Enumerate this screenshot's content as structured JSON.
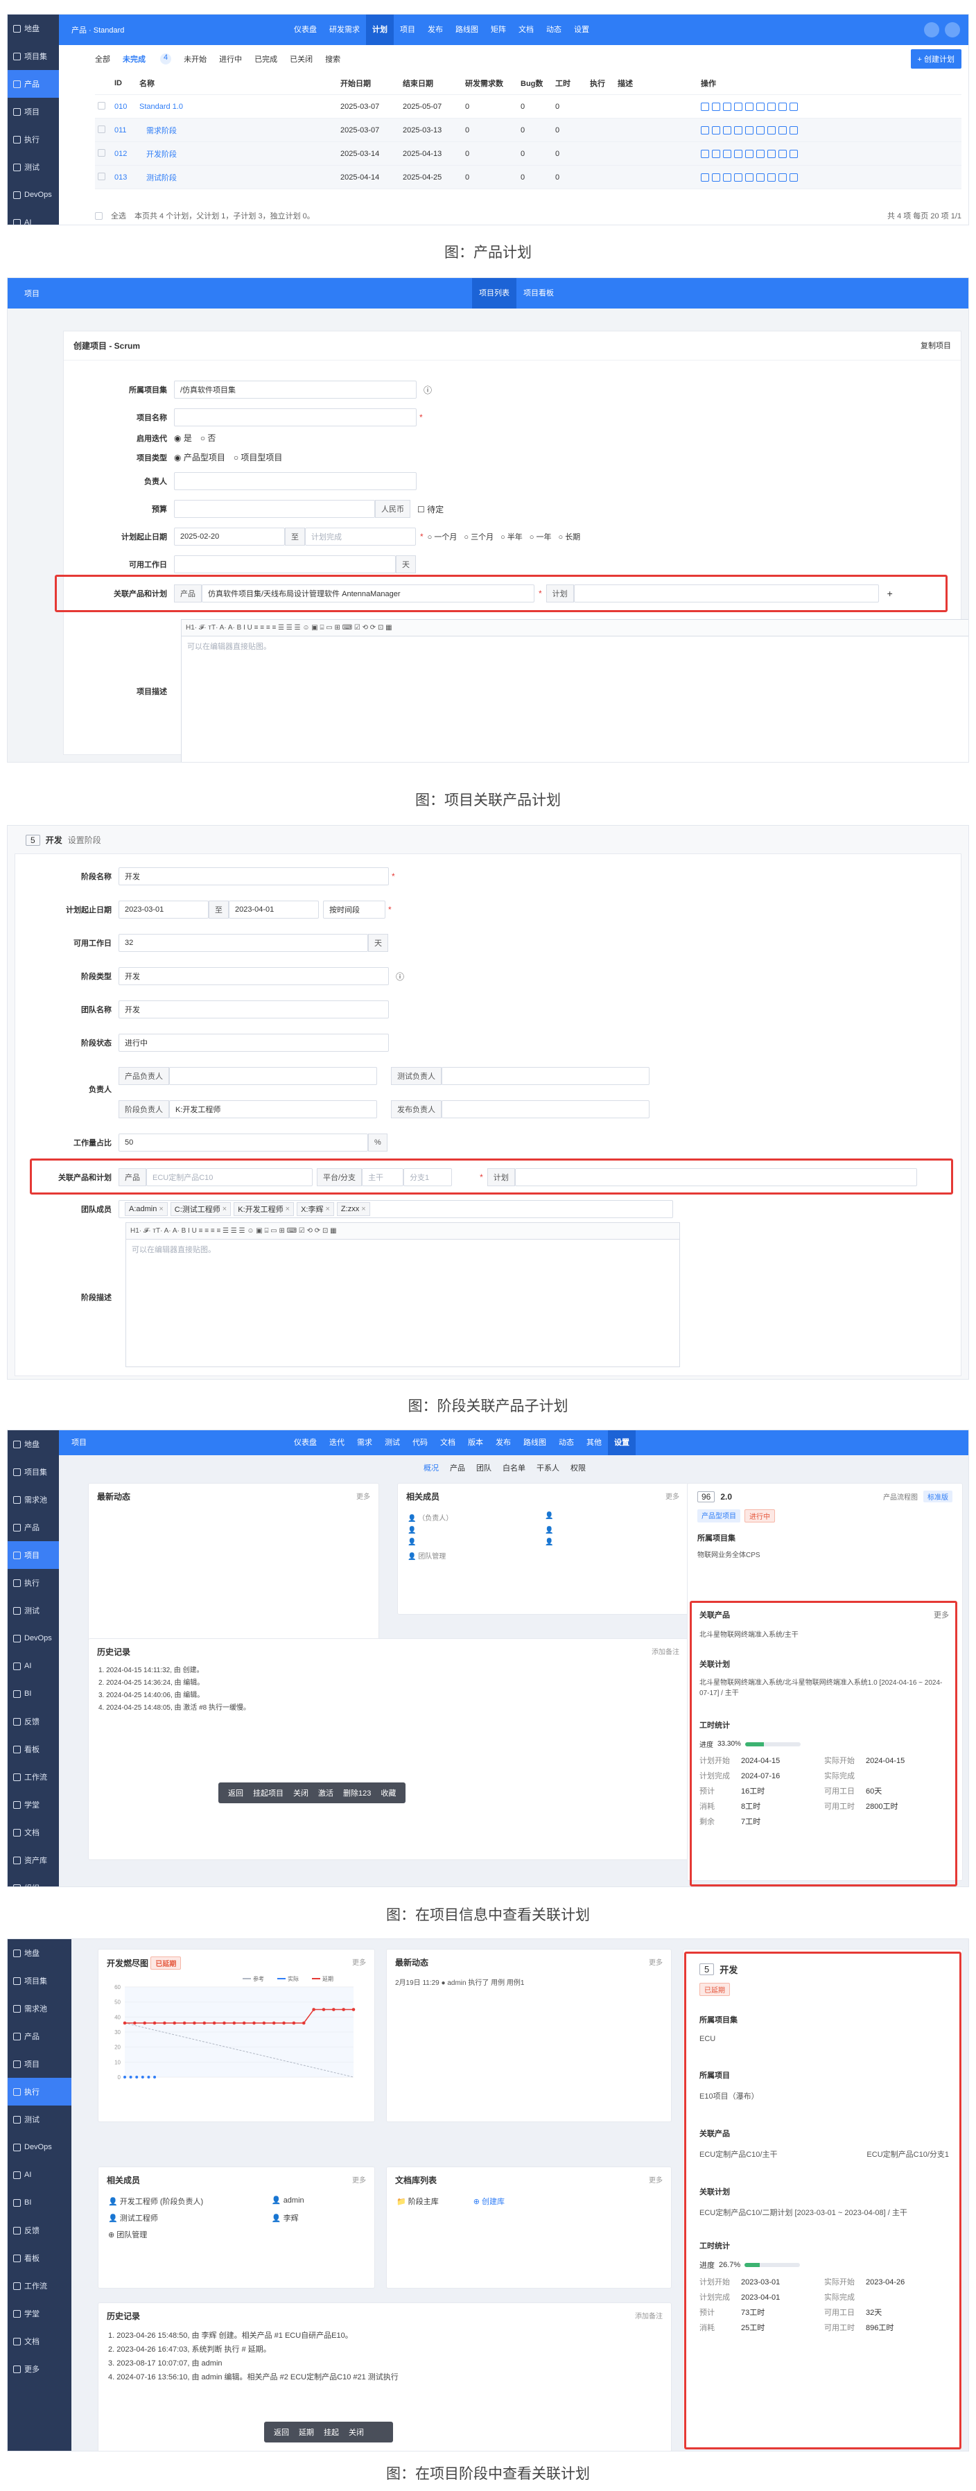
{
  "s1": {
    "sidebar": [
      "地盘",
      "项目集",
      "产品",
      "项目",
      "执行",
      "测试",
      "DevOps",
      "AI"
    ],
    "crumb": "产品 · Standard",
    "nav": [
      "仪表盘",
      "研发需求",
      "计划",
      "项目",
      "发布",
      "路线图",
      "矩阵",
      "文档",
      "动态",
      "设置"
    ],
    "tabs": [
      "全部",
      "未完成",
      "未开始",
      "进行中",
      "已完成",
      "已关闭",
      "搜索"
    ],
    "tab_count": "4",
    "create_btn": "+ 创建计划",
    "headers": [
      "ID",
      "名称",
      "开始日期",
      "结束日期",
      "研发需求数",
      "Bug数",
      "工时",
      "执行",
      "描述",
      "操作"
    ],
    "rows": [
      {
        "id": "010",
        "name": "Standard 1.0",
        "start": "2025-03-07",
        "end": "2025-05-07",
        "req": "0",
        "bug": "0",
        "hours": "0",
        "sub": false
      },
      {
        "id": "011",
        "name": "需求阶段",
        "start": "2025-03-07",
        "end": "2025-03-13",
        "req": "0",
        "bug": "0",
        "hours": "0",
        "sub": true
      },
      {
        "id": "012",
        "name": "开发阶段",
        "start": "2025-03-14",
        "end": "2025-04-13",
        "req": "0",
        "bug": "0",
        "hours": "0",
        "sub": true
      },
      {
        "id": "013",
        "name": "测试阶段",
        "start": "2025-04-14",
        "end": "2025-04-25",
        "req": "0",
        "bug": "0",
        "hours": "0",
        "sub": true
      }
    ],
    "footer_select": "全选",
    "footer_text": "本页共 4 个计划，父计划 1，子计划 3，独立计划 0。",
    "pager": "共 4 项  每页 20 项  1/1"
  },
  "cap1": "图：产品计划",
  "s2": {
    "top_left": "项目",
    "top_tabs": [
      "项目列表",
      "项目看板"
    ],
    "panel_title": "创建项目 - Scrum",
    "copy_btn": "复制项目",
    "program_label": "所属项目集",
    "program_value": "/仿真软件项目集",
    "name_label": "项目名称",
    "multi_label": "启用迭代",
    "multi_opts": [
      "是",
      "否"
    ],
    "type_label": "项目类型",
    "type_opts": [
      "产品型项目",
      "项目型项目"
    ],
    "owner_label": "负责人",
    "budget_label": "预算",
    "budget_unit": "人民币",
    "budget_tbd": "待定",
    "date_label": "计划起止日期",
    "date_start": "2025-02-20",
    "date_to": "至",
    "date_end_ph": "计划完成",
    "date_opts": [
      "一个月",
      "三个月",
      "半年",
      "一年",
      "长期"
    ],
    "days_label": "可用工作日",
    "days_unit": "天",
    "link_label": "关联产品和计划",
    "link_product_addon": "产品",
    "link_product": "仿真软件项目集/天线布局设计管理软件 AntennaManager",
    "link_plan_addon": "计划",
    "link_plus": "+",
    "desc_label": "项目描述",
    "editor_tools": "H1· 𝓕· ᴛT· A· A· B  I  U  ≡ ≡ ≡ ≡ ☰ ☰ ☰ ☺ ▣ ⌸ ▭ ⊞ ⌨ ☑ ⟲ ⟳ ⊡ ▦",
    "editor_ph": "可以在编辑器直接贴图。"
  },
  "cap2": "图：项目关联产品计划",
  "s3": {
    "hdr_num": "5",
    "hdr_title": "开发",
    "hdr_sub": "设置阶段",
    "name_label": "阶段名称",
    "name_value": "开发",
    "date_label": "计划起止日期",
    "date_start": "2023-03-01",
    "date_to": "至",
    "date_end": "2023-04-01",
    "date_mode": "按时间段",
    "days_label": "可用工作日",
    "days_value": "32",
    "days_unit": "天",
    "type_label": "阶段类型",
    "type_value": "开发",
    "team_label": "团队名称",
    "team_value": "开发",
    "status_label": "阶段状态",
    "status_value": "进行中",
    "owner_label": "负责人",
    "owner_fields": [
      [
        "产品负责人",
        ""
      ],
      [
        "测试负责人",
        ""
      ],
      [
        "阶段负责人",
        "K:开发工程师"
      ],
      [
        "发布负责人",
        ""
      ]
    ],
    "percent_label": "工作量占比",
    "percent_value": "50",
    "percent_unit": "%",
    "link_label": "关联产品和计划",
    "link_product_addon": "产品",
    "link_product": "ECU定制产品C10",
    "platform_addon": "平台/分支",
    "platform_value": "主干",
    "platform_branch": "分支1",
    "link_plan_addon": "计划",
    "members_label": "团队成员",
    "members": [
      "A:admin",
      "C:测试工程师",
      "K:开发工程师",
      "X:李辉",
      "Z:zxx"
    ],
    "desc_label": "阶段描述",
    "editor_tools": "H1· 𝓕· ᴛT· A· A· B  I  U  ≡ ≡ ≡ ≡ ☰ ☰ ☰ ☺ ▣ ⌸ ▭ ⊞ ⌨ ☑ ⟲ ⟳ ⊡ ▦",
    "editor_ph": "可以在编辑器直接贴图。"
  },
  "cap3": "图：阶段关联产品子计划",
  "s4": {
    "sidebar": [
      "地盘",
      "项目集",
      "需求池",
      "产品",
      "项目",
      "执行",
      "测试",
      "DevOps",
      "AI",
      "BI",
      "反馈",
      "看板",
      "工作流",
      "学堂",
      "文档",
      "资产库",
      "组织"
    ],
    "crumb": "项目",
    "nav": [
      "仪表盘",
      "迭代",
      "需求",
      "测试",
      "代码",
      "文档",
      "版本",
      "发布",
      "路线图",
      "动态",
      "其他",
      "设置"
    ],
    "subnav": [
      "概况",
      "产品",
      "团队",
      "白名单",
      "干系人",
      "权限"
    ],
    "card_dyn": "最新动态",
    "card_more": "更多",
    "card_members": "相关成员",
    "members": [
      "（负责人）",
      "",
      "",
      "",
      "",
      "",
      "团队管理"
    ],
    "history": "历史记录",
    "history_add": "添加备注",
    "history_items": [
      "1. 2024-04-15 14:11:32, 由            创建。",
      "2. 2024-04-25 14:36:24, 由            编辑。",
      "3. 2024-04-25 14:40:06, 由            编辑。",
      "4. 2024-04-25 14:48:05, 由            激活 #8 执行一缓慢。"
    ],
    "actions": [
      "返回",
      "挂起项目",
      "关闭",
      "激活",
      "删除123",
      "收藏"
    ],
    "info_num": "96",
    "info_title": "2.0",
    "info_type": "产品型项目",
    "info_status": "进行中",
    "info_side": "产品流程图",
    "info_side_tag": "标准版",
    "program_title": "所属项目集",
    "program_value": "物联网业务全体CPS",
    "product_title": "关联产品",
    "product_more": "更多",
    "product_value": "北斗星物联网终端准入系统/主干",
    "plan_title": "关联计划",
    "plan_value": "北斗星物联网终端准入系统/北斗星物联网终端准入系统1.0 [2024-04-16 ~ 2024-07-17] / 主干",
    "stats_title": "工时统计",
    "progress_label": "进度",
    "progress_value": "33.30%",
    "kv": [
      [
        "计划开始",
        "2024-04-15"
      ],
      [
        "实际开始",
        "2024-04-15"
      ],
      [
        "计划完成",
        "2024-07-16"
      ],
      [
        "实际完成",
        ""
      ],
      [
        "预计",
        "16工时"
      ],
      [
        "可用工日",
        "60天"
      ],
      [
        "消耗",
        "8工时"
      ],
      [
        "可用工时",
        "2800工时"
      ],
      [
        "剩余",
        "7工时"
      ]
    ]
  },
  "cap4": "图：在项目信息中查看关联计划",
  "s5": {
    "sidebar": [
      "地盘",
      "项目集",
      "需求池",
      "产品",
      "项目",
      "执行",
      "测试",
      "DevOps",
      "AI",
      "BI",
      "反馈",
      "看板",
      "工作流",
      "学堂",
      "文档",
      "更多"
    ],
    "burn_title": "开发燃尽图",
    "burn_tag": "已延期",
    "burn_more": "更多",
    "burn_legend": [
      "参考",
      "实际",
      "延期"
    ],
    "burn_yticks": [
      "60",
      "50",
      "40",
      "30",
      "20",
      "10",
      "0"
    ],
    "dyn_title": "最新动态",
    "dyn_more": "更多",
    "dyn_line": "2月19日 11:29  ● admin  执行了 用例  用例1",
    "members_title": "相关成员",
    "members_more": "更多",
    "members": [
      "开发工程师 (阶段负责人)",
      "admin",
      "测试工程师",
      "李辉",
      "团队管理"
    ],
    "doc_title": "文档库列表",
    "doc_more": "更多",
    "doc_items": [
      "阶段主库",
      "创建库"
    ],
    "history": "历史记录",
    "history_add": "添加备注",
    "history_items": [
      "1. 2023-04-26 15:48:50, 由 李辉 创建。相关产品 #1 ECU自研产品E10。",
      "2. 2023-04-26 16:47:03, 系统判断       执行 #         延期。",
      "3. 2023-08-17 10:07:07, 由 admin",
      "4. 2024-07-16 13:56:10, 由 admin 编辑。相关产品 #2 ECU定制产品C10  #21 测试执行"
    ],
    "actions": [
      "返回",
      "延期",
      "挂起",
      "关闭",
      "",
      ""
    ],
    "info_num": "5",
    "info_title": "开发",
    "info_tag": "已延期",
    "program_title": "所属项目集",
    "program_value": "ECU",
    "project_title": "所属项目",
    "project_value": "E10项目（瀑布）",
    "product_title": "关联产品",
    "products": [
      "ECU定制产品C10/主干",
      "ECU定制产品C10/分支1"
    ],
    "plan_title": "关联计划",
    "plan_value": "ECU定制产品C10/二期计划 [2023-03-01 ~ 2023-04-08] / 主干",
    "stats_title": "工时统计",
    "progress_label": "进度",
    "progress_value": "26.7%",
    "kv": [
      [
        "计划开始",
        "2023-03-01"
      ],
      [
        "实际开始",
        "2023-04-26"
      ],
      [
        "计划完成",
        "2023-04-01"
      ],
      [
        "实际完成",
        ""
      ],
      [
        "预计",
        "73工时"
      ],
      [
        "可用工日",
        "32天"
      ],
      [
        "消耗",
        "25工时"
      ],
      [
        "可用工时",
        "896工时"
      ]
    ]
  },
  "cap5": "图：在项目阶段中查看关联计划",
  "burn_data": {
    "type": "line",
    "reference": [
      36,
      0
    ],
    "actual": [
      36,
      36,
      36,
      36,
      36,
      36,
      36,
      36,
      36,
      36,
      36,
      36,
      36,
      36,
      36,
      36,
      36,
      36,
      36,
      45,
      45,
      45,
      45,
      45
    ],
    "delay_from": 19
  }
}
